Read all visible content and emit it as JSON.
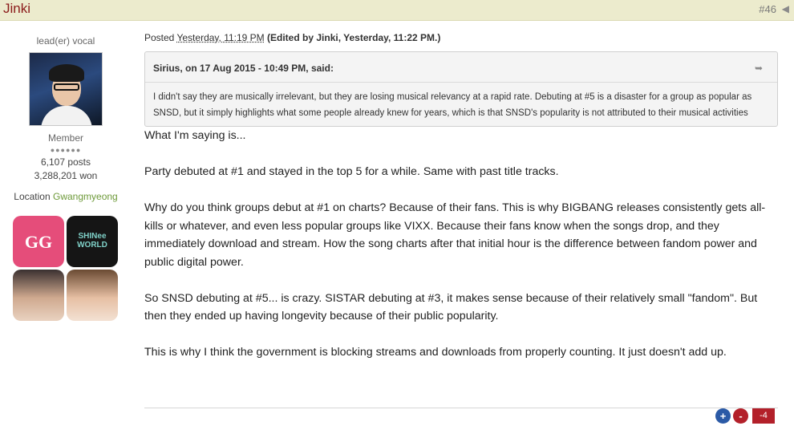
{
  "header": {
    "author": "Jinki",
    "post_number": "#46",
    "share_icon": "share-icon"
  },
  "profile": {
    "custom_title": "lead(er) vocal",
    "avatar": "avatar-photo",
    "rank": "Member",
    "rank_pips": "●●●●●●",
    "posts": "6,107 posts",
    "currency": "3,288,201 won",
    "location_label": "Location",
    "location_value": "Gwangmyeong",
    "badges": [
      {
        "name": "gg-badge",
        "text": "GG"
      },
      {
        "name": "shinee-world-badge",
        "text": "SHINee WORLD"
      },
      {
        "name": "member-photo-badge-1",
        "text": ""
      },
      {
        "name": "member-photo-badge-2",
        "text": ""
      }
    ]
  },
  "post": {
    "posted_prefix": "Posted",
    "posted_time": "Yesterday, 11:19 PM",
    "edited": "(Edited by Jinki, Yesterday, 11:22 PM.)",
    "quote": {
      "citation": "Sirius, on 17 Aug 2015 - 10:49 PM, said:",
      "jump_icon": "view-post-arrow-icon",
      "text": "I didn't say they are musically irrelevant, but they are losing musical relevancy at a rapid rate. Debuting at #5 is a disaster for a group as popular as SNSD, but it simply highlights what some people already knew for years, which is that SNSD's popularity is not attributed to their musical activities"
    },
    "paragraphs": [
      "What I'm saying is...",
      "Party debuted at #1 and stayed in the top 5 for a while. Same with past title tracks.",
      "Why do you think groups debut at #1 on charts? Because of their fans. This is why BIGBANG releases consistently gets all-kills or whatever, and even less popular groups like VIXX. Because their fans know when the songs drop, and they immediately download and stream. How the song charts after that initial hour is the difference between fandom power and public digital power.",
      "So SNSD debuting at #5... is crazy. SISTAR debuting at #3, it makes sense because of their relatively small \"fandom\". But then they ended up having longevity because of their public popularity.",
      "This is why I think the government is blocking streams and downloads from properly counting. It just doesn't add up."
    ]
  },
  "reputation": {
    "plus": "+",
    "minus": "-",
    "score": "-4",
    "colors": {
      "plus": "#2b5aa6",
      "minus": "#b3202a"
    }
  }
}
